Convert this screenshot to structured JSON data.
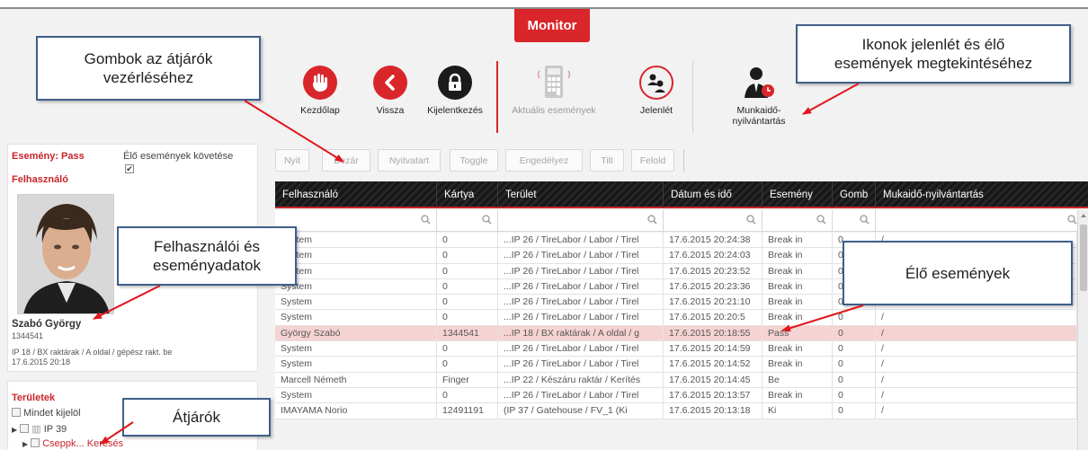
{
  "monitor_tab": "Monitor",
  "toolbar": {
    "items": [
      {
        "label": "Kezdőlap",
        "icon": "hand-stop-icon"
      },
      {
        "label": "Vissza",
        "icon": "back-chevron-icon"
      },
      {
        "label": "Kijelentkezés",
        "icon": "lock-icon"
      },
      {
        "label": "Aktuális események",
        "icon": "calculator-icon"
      },
      {
        "label": "Jelenlét",
        "icon": "people-icon"
      },
      {
        "label": "Munkaidő-\nnyilvántartás",
        "icon": "person-clock-icon"
      }
    ]
  },
  "callouts": {
    "gombok": "Gombok az átjárók\nvezérléséhez",
    "ikonok": "Ikonok jelenlét és élő\nesemények megtekintéséhez",
    "felhasznaloi": "Felhasználói és\neseményadatok",
    "elo": "Élő események",
    "atjarok": "Átjárók"
  },
  "event_panel": {
    "event_label": "Esemény: Pass",
    "live_follow_label": "Élő események követése",
    "live_follow_checked": true,
    "user_section": "Felhasználó",
    "user_name": "Szabó György",
    "user_card": "1344541",
    "event_location": "IP 18 / BX raktárak / A oldal / gépész rakt. be",
    "event_time": "17.6.2015 20:18"
  },
  "areas_panel": {
    "title": "Területek",
    "select_all": "Mindet kijelöl",
    "tree": [
      {
        "label": "IP 39"
      },
      {
        "label": "Cseppk... Keresés"
      }
    ]
  },
  "action_buttons": [
    "Nyit",
    "Bezár",
    "Nyitvatart",
    "Toggle",
    "Engedélyez",
    "Tilt",
    "Felold"
  ],
  "grid": {
    "columns": [
      "Felhasználó",
      "Kártya",
      "Terület",
      "Dátum és idő",
      "Esemény",
      "Gomb",
      "Mukaidő-nyilvántartás"
    ],
    "rows": [
      {
        "user": "System",
        "card": "0",
        "area": "...IP 26 / TireLabor / Labor / Tirel",
        "datetime": "17.6.2015 20:24:38",
        "event": "Break in",
        "button": "0",
        "time_tracking": "/"
      },
      {
        "user": "System",
        "card": "0",
        "area": "...IP 26 / TireLabor / Labor / Tirel",
        "datetime": "17.6.2015 20:24:03",
        "event": "Break in",
        "button": "0",
        "time_tracking": "/"
      },
      {
        "user": "System",
        "card": "0",
        "area": "...IP 26 / TireLabor / Labor / Tirel",
        "datetime": "17.6.2015 20:23:52",
        "event": "Break in",
        "button": "0",
        "time_tracking": "/"
      },
      {
        "user": "System",
        "card": "0",
        "area": "...IP 26 / TireLabor / Labor / Tirel",
        "datetime": "17.6.2015 20:23:36",
        "event": "Break in",
        "button": "0",
        "time_tracking": "/"
      },
      {
        "user": "System",
        "card": "0",
        "area": "...IP 26 / TireLabor / Labor / Tirel",
        "datetime": "17.6.2015 20:21:10",
        "event": "Break in",
        "button": "0",
        "time_tracking": "/"
      },
      {
        "user": "System",
        "card": "0",
        "area": "...IP 26 / TireLabor / Labor / Tirel",
        "datetime": "17.6.2015 20:20:5",
        "event": "Break in",
        "button": "0",
        "time_tracking": "/"
      },
      {
        "user": "György Szabó",
        "card": "1344541",
        "area": "...IP 18 / BX raktárak / A oldal / g",
        "datetime": "17.6.2015 20:18:55",
        "event": "Pass",
        "button": "0",
        "time_tracking": "/",
        "highlight": true
      },
      {
        "user": "System",
        "card": "0",
        "area": "...IP 26 / TireLabor / Labor / Tirel",
        "datetime": "17.6.2015 20:14:59",
        "event": "Break in",
        "button": "0",
        "time_tracking": "/"
      },
      {
        "user": "System",
        "card": "0",
        "area": "...IP 26 / TireLabor / Labor / Tirel",
        "datetime": "17.6.2015 20:14:52",
        "event": "Break in",
        "button": "0",
        "time_tracking": "/"
      },
      {
        "user": "Marcell Németh",
        "card": "Finger",
        "area": "...IP 22 / Készáru raktár / Kerítés",
        "datetime": "17.6.2015 20:14:45",
        "event": "Be",
        "button": "0",
        "time_tracking": "/"
      },
      {
        "user": "System",
        "card": "0",
        "area": "...IP 26 / TireLabor / Labor / Tirel",
        "datetime": "17.6.2015 20:13:57",
        "event": "Break in",
        "button": "0",
        "time_tracking": "/"
      },
      {
        "user": "IMAYAMA Norio",
        "card": "12491191",
        "area": "(IP 37 / Gatehouse / FV_1 (Ki",
        "datetime": "17.6.2015 20:13:18",
        "event": "Ki",
        "button": "0",
        "time_tracking": "/"
      }
    ]
  },
  "colors": {
    "accent_red": "#d9262b",
    "header_dark": "#1b1b1b",
    "callout_border": "#3e5f8a",
    "highlight_row": "#f6d3d3",
    "panel_bg": "#f2f2f2"
  }
}
